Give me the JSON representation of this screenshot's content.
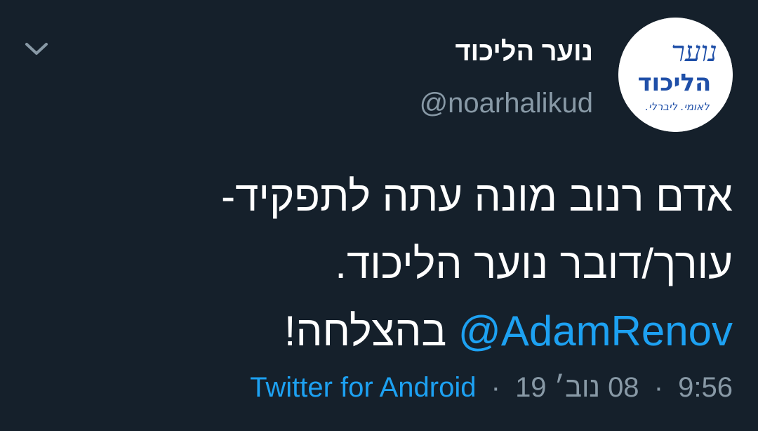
{
  "tweet": {
    "display_name": "נוער הליכוד",
    "handle": "@noarhalikud",
    "text_line_1": "אדם רנוב מונה עתה לתפקיד-",
    "text_line_2": "עורך/דובר נוער הליכוד.",
    "mention": "@AdamRenov",
    "text_line_3_suffix": "בהצלחה!",
    "time": "9:56",
    "date": "08 נוב׳ 19",
    "separator": "·",
    "source": "Twitter for Android"
  },
  "avatar": {
    "logo_top": "נוער",
    "logo_main": "הליכוד",
    "logo_slogan": "לאומי. ליברלי."
  },
  "colors": {
    "background": "#15202b",
    "text": "#ffffff",
    "muted": "#8899a6",
    "accent": "#1da1f2",
    "logo_blue": "#1f4fa8"
  },
  "icons": {
    "menu": "chevron-down-icon"
  }
}
